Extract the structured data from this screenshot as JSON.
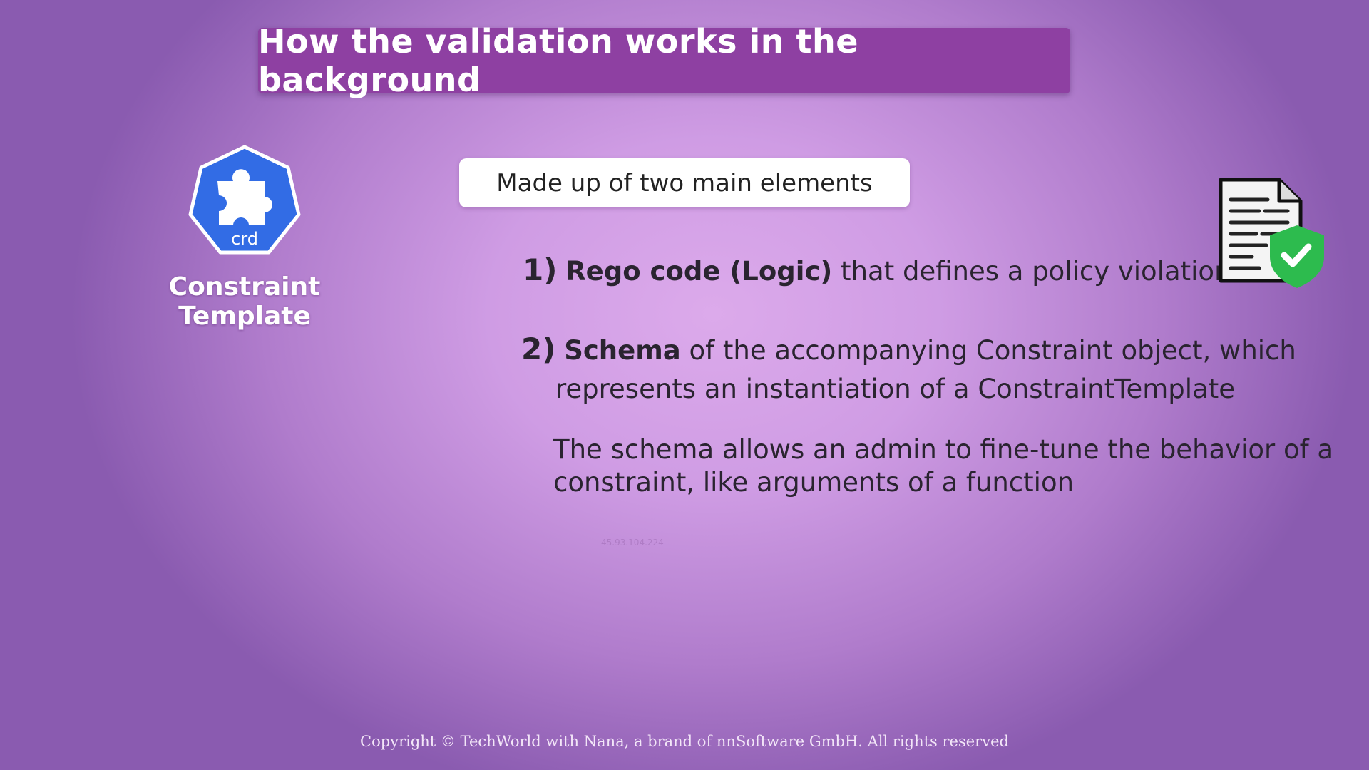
{
  "title": "How the validation works in the background",
  "left_panel": {
    "icon_label": "crd",
    "caption": "Constraint Template"
  },
  "pill_text": "Made up of two main elements",
  "items": [
    {
      "number": "1)",
      "bold": "Rego code (Logic)",
      "rest": " that defines a policy violation"
    },
    {
      "number": "2)",
      "bold": "Schema",
      "rest": " of the accompanying Constraint object, which",
      "line2": "represents an instantiation of a ConstraintTemplate"
    }
  ],
  "paragraph": {
    "line1": "The schema allows an admin to fine-tune the behavior of a",
    "line2": "constraint, like arguments of a function"
  },
  "watermark": "45.93.104.224",
  "footer": "Copyright © TechWorld with Nana, a brand of nnSoftware GmbH. All rights reserved",
  "colors": {
    "title_bg": "#8e40a2",
    "crd_blue": "#326ce5",
    "shield_green": "#2dbb4e"
  }
}
